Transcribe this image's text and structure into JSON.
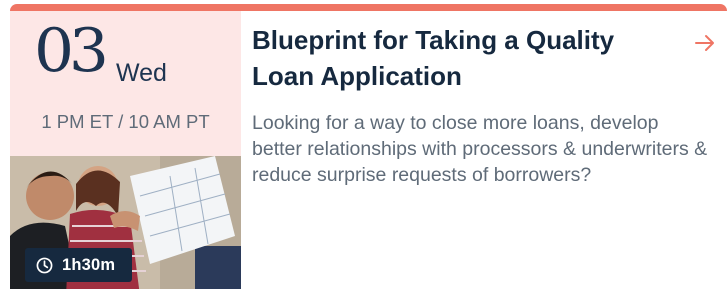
{
  "event": {
    "day_number": "03",
    "weekday": "Wed",
    "time": "1 PM ET / 10 AM PT",
    "duration": "1h30m",
    "title": "Blueprint for Taking a Quality Loan Application",
    "description": "Looking for a way to close more loans, develop better relationships with processors & underwriters & reduce surprise requests of borrowers?"
  },
  "colors": {
    "accent": "#ef7564",
    "date_panel_bg": "#fde7e6",
    "navy": "#16293f",
    "muted_text": "#5f6b78"
  },
  "icons": {
    "duration": "clock-icon",
    "open": "arrow-right-icon"
  }
}
